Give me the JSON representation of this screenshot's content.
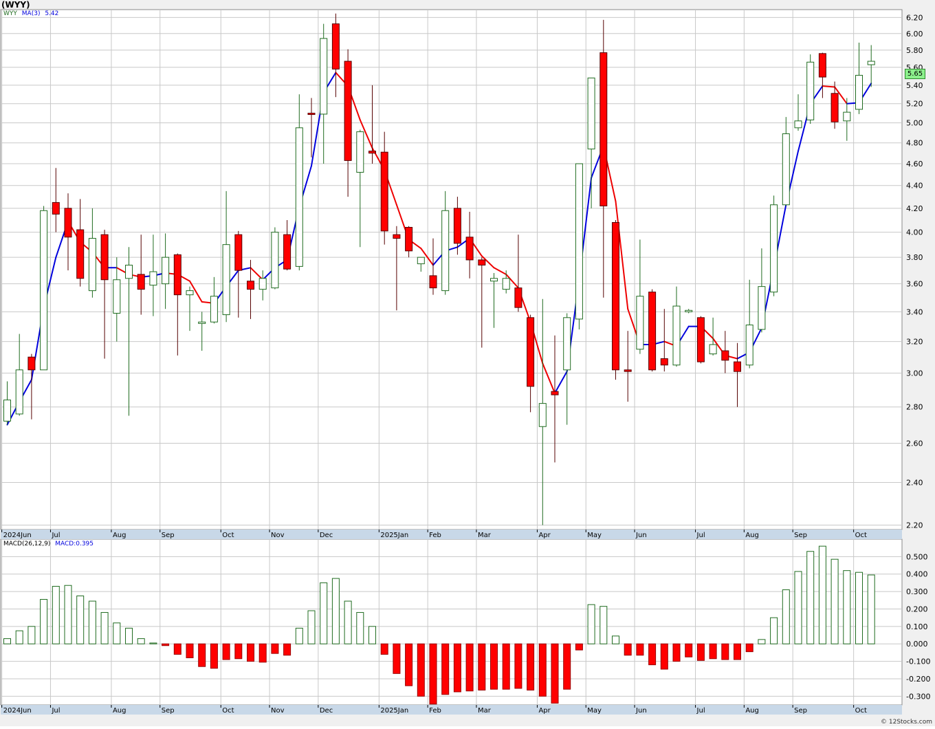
{
  "chart": {
    "title": "(WYY)",
    "legend_symbol": "WYY",
    "legend_ma_label": "MA(3)",
    "legend_ma_value": "5.42",
    "macd_label": "MACD(26,12,9)",
    "macd_value_label": "MACD:0.395",
    "last_price_label": "5.65",
    "copyright": "© 12Stocks.com",
    "colors": {
      "up": "#1f6b1f",
      "down": "#ff0000",
      "ma_up": "#0000dd",
      "ma_down": "#ee0000",
      "macd_pos": "#1f6b1f",
      "macd_neg": "#ff0000",
      "grid": "#c8c8c8",
      "axis_band": "#c8d8e8"
    }
  },
  "chart_data": [
    {
      "type": "candlestick",
      "scale": "log",
      "ylim": [
        2.18,
        6.3
      ],
      "y_ticks": [
        "2.20",
        "2.40",
        "2.60",
        "2.80",
        "3.00",
        "3.20",
        "3.40",
        "3.60",
        "3.80",
        "4.00",
        "4.20",
        "4.40",
        "4.60",
        "4.80",
        "5.00",
        "5.20",
        "5.40",
        "5.60",
        "5.80",
        "6.00",
        "6.20"
      ],
      "x_tick_labels": [
        {
          "i": 0,
          "label": "2024Jun"
        },
        {
          "i": 4,
          "label": "Jul"
        },
        {
          "i": 9,
          "label": "Aug"
        },
        {
          "i": 13,
          "label": "Sep"
        },
        {
          "i": 18,
          "label": "Oct"
        },
        {
          "i": 22,
          "label": "Nov"
        },
        {
          "i": 26,
          "label": "Dec"
        },
        {
          "i": 31,
          "label": "2025Jan"
        },
        {
          "i": 35,
          "label": "Feb"
        },
        {
          "i": 39,
          "label": "Mar"
        },
        {
          "i": 44,
          "label": "Apr"
        },
        {
          "i": 48,
          "label": "May"
        },
        {
          "i": 52,
          "label": "Jun"
        },
        {
          "i": 57,
          "label": "Jul"
        },
        {
          "i": 61,
          "label": "Aug"
        },
        {
          "i": 65,
          "label": "Sep"
        },
        {
          "i": 70,
          "label": "Oct"
        }
      ],
      "candles": [
        {
          "o": 2.72,
          "h": 2.95,
          "l": 2.7,
          "c": 2.84
        },
        {
          "o": 2.76,
          "h": 3.25,
          "l": 2.75,
          "c": 3.02
        },
        {
          "o": 3.1,
          "h": 3.12,
          "l": 2.73,
          "c": 3.02
        },
        {
          "o": 3.02,
          "h": 4.22,
          "l": 3.02,
          "c": 4.18
        },
        {
          "o": 4.25,
          "h": 4.56,
          "l": 4.0,
          "c": 4.15
        },
        {
          "o": 4.2,
          "h": 4.33,
          "l": 3.7,
          "c": 3.96
        },
        {
          "o": 4.02,
          "h": 4.28,
          "l": 3.58,
          "c": 3.64
        },
        {
          "o": 3.55,
          "h": 4.2,
          "l": 3.5,
          "c": 3.95
        },
        {
          "o": 3.98,
          "h": 4.02,
          "l": 3.09,
          "c": 3.63
        },
        {
          "o": 3.39,
          "h": 3.8,
          "l": 3.2,
          "c": 3.63
        },
        {
          "o": 3.64,
          "h": 3.88,
          "l": 2.75,
          "c": 3.74
        },
        {
          "o": 3.67,
          "h": 3.98,
          "l": 3.38,
          "c": 3.56
        },
        {
          "o": 3.59,
          "h": 3.98,
          "l": 3.37,
          "c": 3.69
        },
        {
          "o": 3.6,
          "h": 3.99,
          "l": 3.42,
          "c": 3.8
        },
        {
          "o": 3.82,
          "h": 3.83,
          "l": 3.11,
          "c": 3.52
        },
        {
          "o": 3.52,
          "h": 3.58,
          "l": 3.27,
          "c": 3.55
        },
        {
          "o": 3.32,
          "h": 3.4,
          "l": 3.14,
          "c": 3.33
        },
        {
          "o": 3.33,
          "h": 3.65,
          "l": 3.32,
          "c": 3.51
        },
        {
          "o": 3.38,
          "h": 4.35,
          "l": 3.33,
          "c": 3.9
        },
        {
          "o": 3.98,
          "h": 4.01,
          "l": 3.36,
          "c": 3.7
        },
        {
          "o": 3.62,
          "h": 3.78,
          "l": 3.35,
          "c": 3.56
        },
        {
          "o": 3.56,
          "h": 3.7,
          "l": 3.48,
          "c": 3.64
        },
        {
          "o": 3.57,
          "h": 4.04,
          "l": 3.56,
          "c": 4.0
        },
        {
          "o": 3.98,
          "h": 4.1,
          "l": 3.7,
          "c": 3.71
        },
        {
          "o": 3.73,
          "h": 5.3,
          "l": 3.7,
          "c": 4.95
        },
        {
          "o": 5.1,
          "h": 5.26,
          "l": 4.66,
          "c": 5.09
        },
        {
          "o": 5.09,
          "h": 6.12,
          "l": 4.6,
          "c": 5.94
        },
        {
          "o": 6.12,
          "h": 6.25,
          "l": 5.27,
          "c": 5.58
        },
        {
          "o": 5.67,
          "h": 5.81,
          "l": 4.3,
          "c": 4.63
        },
        {
          "o": 4.52,
          "h": 4.93,
          "l": 3.88,
          "c": 4.91
        },
        {
          "o": 4.72,
          "h": 5.4,
          "l": 4.6,
          "c": 4.7
        },
        {
          "o": 4.71,
          "h": 4.91,
          "l": 3.9,
          "c": 4.01
        },
        {
          "o": 3.98,
          "h": 4.05,
          "l": 3.41,
          "c": 3.95
        },
        {
          "o": 4.04,
          "h": 4.05,
          "l": 3.8,
          "c": 3.85
        },
        {
          "o": 3.75,
          "h": 3.8,
          "l": 3.69,
          "c": 3.8
        },
        {
          "o": 3.66,
          "h": 3.95,
          "l": 3.52,
          "c": 3.57
        },
        {
          "o": 3.55,
          "h": 4.35,
          "l": 3.52,
          "c": 4.18
        },
        {
          "o": 4.2,
          "h": 4.3,
          "l": 3.82,
          "c": 3.91
        },
        {
          "o": 3.96,
          "h": 4.17,
          "l": 3.64,
          "c": 3.78
        },
        {
          "o": 3.78,
          "h": 3.8,
          "l": 3.16,
          "c": 3.74
        },
        {
          "o": 3.62,
          "h": 3.68,
          "l": 3.29,
          "c": 3.64
        },
        {
          "o": 3.56,
          "h": 3.7,
          "l": 3.53,
          "c": 3.64
        },
        {
          "o": 3.57,
          "h": 3.98,
          "l": 3.4,
          "c": 3.43
        },
        {
          "o": 3.36,
          "h": 3.38,
          "l": 2.77,
          "c": 2.92
        },
        {
          "o": 2.69,
          "h": 3.49,
          "l": 2.2,
          "c": 2.82
        },
        {
          "o": 2.89,
          "h": 3.24,
          "l": 2.5,
          "c": 2.87
        },
        {
          "o": 3.02,
          "h": 3.39,
          "l": 2.7,
          "c": 3.36
        },
        {
          "o": 3.35,
          "h": 4.6,
          "l": 3.28,
          "c": 4.6
        },
        {
          "o": 4.74,
          "h": 4.95,
          "l": 4.2,
          "c": 5.48
        },
        {
          "o": 5.77,
          "h": 6.17,
          "l": 3.5,
          "c": 4.22
        },
        {
          "o": 4.08,
          "h": 4.1,
          "l": 2.96,
          "c": 3.02
        },
        {
          "o": 3.02,
          "h": 3.27,
          "l": 2.83,
          "c": 3.01
        },
        {
          "o": 3.15,
          "h": 3.94,
          "l": 3.12,
          "c": 3.51
        },
        {
          "o": 3.54,
          "h": 3.56,
          "l": 3.01,
          "c": 3.02
        },
        {
          "o": 3.09,
          "h": 3.42,
          "l": 3.01,
          "c": 3.05
        },
        {
          "o": 3.05,
          "h": 3.58,
          "l": 3.04,
          "c": 3.44
        },
        {
          "o": 3.4,
          "h": 3.42,
          "l": 3.39,
          "c": 3.41
        },
        {
          "o": 3.36,
          "h": 3.37,
          "l": 3.06,
          "c": 3.07
        },
        {
          "o": 3.12,
          "h": 3.36,
          "l": 3.11,
          "c": 3.18
        },
        {
          "o": 3.14,
          "h": 3.27,
          "l": 3.0,
          "c": 3.08
        },
        {
          "o": 3.07,
          "h": 3.19,
          "l": 2.8,
          "c": 3.01
        },
        {
          "o": 3.05,
          "h": 3.63,
          "l": 3.03,
          "c": 3.31
        },
        {
          "o": 3.28,
          "h": 3.87,
          "l": 3.26,
          "c": 3.58
        },
        {
          "o": 3.54,
          "h": 4.31,
          "l": 3.51,
          "c": 4.23
        },
        {
          "o": 4.23,
          "h": 5.06,
          "l": 4.22,
          "c": 4.89
        },
        {
          "o": 4.95,
          "h": 5.3,
          "l": 4.92,
          "c": 5.02
        },
        {
          "o": 5.03,
          "h": 5.75,
          "l": 4.99,
          "c": 5.66
        },
        {
          "o": 5.76,
          "h": 5.77,
          "l": 5.26,
          "c": 5.49
        },
        {
          "o": 5.31,
          "h": 5.44,
          "l": 4.94,
          "c": 5.01
        },
        {
          "o": 5.02,
          "h": 5.26,
          "l": 4.82,
          "c": 5.11
        },
        {
          "o": 5.14,
          "h": 5.89,
          "l": 5.09,
          "c": 5.51
        },
        {
          "o": 5.63,
          "h": 5.86,
          "l": 5.38,
          "c": 5.67
        }
      ],
      "ma3": [
        2.7,
        2.83,
        2.96,
        3.43,
        3.8,
        4.09,
        3.92,
        3.84,
        3.72,
        3.72,
        3.67,
        3.65,
        3.66,
        3.68,
        3.67,
        3.62,
        3.47,
        3.46,
        3.58,
        3.7,
        3.72,
        3.63,
        3.72,
        3.78,
        4.21,
        4.58,
        5.32,
        5.54,
        5.39,
        5.03,
        4.75,
        4.54,
        4.23,
        3.94,
        3.87,
        3.74,
        3.85,
        3.88,
        3.95,
        3.81,
        3.72,
        3.67,
        3.57,
        3.33,
        3.06,
        2.88,
        3.01,
        3.63,
        4.47,
        4.77,
        4.26,
        3.42,
        3.18,
        3.18,
        3.2,
        3.17,
        3.3,
        3.3,
        3.22,
        3.11,
        3.09,
        3.13,
        3.29,
        3.72,
        4.23,
        4.72,
        5.2,
        5.39,
        5.38,
        5.2,
        5.21,
        5.42
      ]
    },
    {
      "type": "bar",
      "name": "MACD(26,12,9)",
      "ylim": [
        -0.35,
        0.6
      ],
      "y_ticks": [
        "-0.300",
        "-0.200",
        "-0.100",
        "0.000",
        "0.100",
        "0.200",
        "0.300",
        "0.400",
        "0.500"
      ],
      "values": [
        0.03,
        0.075,
        0.1,
        0.255,
        0.33,
        0.335,
        0.275,
        0.245,
        0.18,
        0.12,
        0.09,
        0.03,
        0.005,
        -0.01,
        -0.06,
        -0.08,
        -0.13,
        -0.14,
        -0.09,
        -0.085,
        -0.1,
        -0.105,
        -0.055,
        -0.065,
        0.09,
        0.19,
        0.35,
        0.375,
        0.245,
        0.18,
        0.1,
        -0.06,
        -0.17,
        -0.24,
        -0.3,
        -0.345,
        -0.29,
        -0.275,
        -0.27,
        -0.265,
        -0.26,
        -0.26,
        -0.255,
        -0.265,
        -0.3,
        -0.34,
        -0.26,
        -0.035,
        0.225,
        0.215,
        0.045,
        -0.065,
        -0.065,
        -0.12,
        -0.145,
        -0.1,
        -0.075,
        -0.095,
        -0.085,
        -0.09,
        -0.09,
        -0.045,
        0.025,
        0.15,
        0.31,
        0.415,
        0.53,
        0.56,
        0.485,
        0.42,
        0.41,
        0.395
      ]
    }
  ]
}
